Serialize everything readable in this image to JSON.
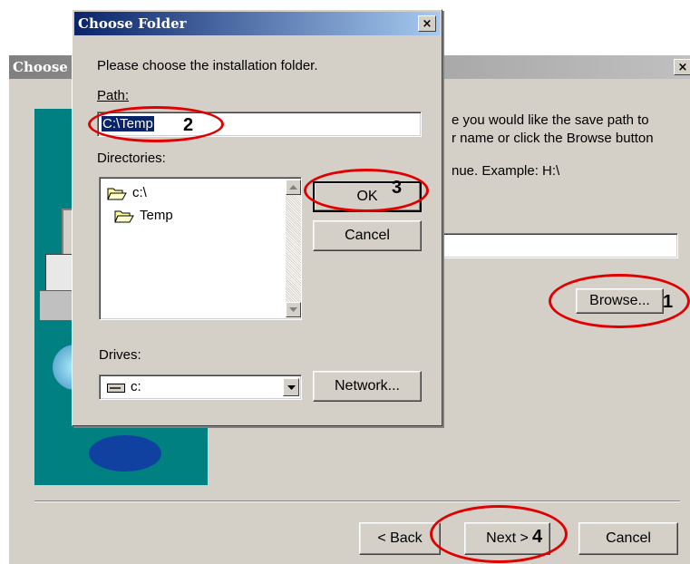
{
  "background_dialog": {
    "title": "Choose",
    "close_label": "×",
    "description_lines": [
      "e you would like the save path to",
      "r name or click the Browse button",
      "nue.  Example: H:\\"
    ],
    "browse_label": "Browse...",
    "back_label": "< Back",
    "back_mnemonic": "B",
    "next_label": "Next >",
    "next_mnemonic": "N",
    "cancel_label": "Cancel"
  },
  "choose_folder": {
    "title": "Choose Folder",
    "close_label": "×",
    "instruction": "Please choose the installation folder.",
    "path_label": "Path:",
    "path_value": "C:\\Temp",
    "directories_label": "Directories:",
    "directories": [
      {
        "name": "c:\\",
        "icon": "open-folder-icon"
      },
      {
        "name": "Temp",
        "icon": "open-folder-icon"
      }
    ],
    "ok_label": "OK",
    "cancel_label": "Cancel",
    "drives_label": "Drives:",
    "drive_value": "c:",
    "network_label": "Network..."
  },
  "annotations": {
    "step1": "1",
    "step2": "2",
    "step3": "3",
    "step4": "4"
  },
  "colors": {
    "title_active": "#0a246a",
    "title_inactive": "#808080",
    "dialog_face": "#d4d0c8",
    "banner_teal": "#008080",
    "selection": "#0a246a",
    "annotation_red": "#e00000"
  }
}
